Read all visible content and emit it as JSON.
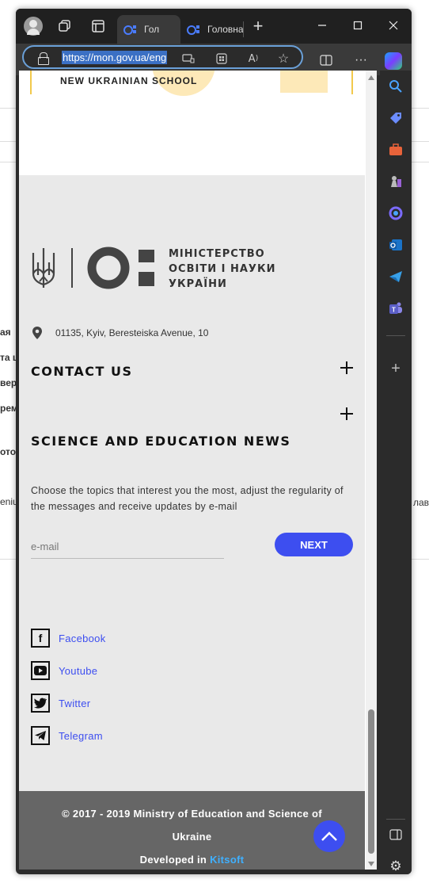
{
  "background_page": {
    "fragments": [
      "ая",
      "та ц",
      "вер",
      "рем",
      "ото",
      "eniu",
      "лав"
    ]
  },
  "browser": {
    "tabs": [
      {
        "title": "Гол",
        "active": true
      },
      {
        "title": "Головна",
        "active": false
      }
    ],
    "url": "https://mon.gov.ua/eng"
  },
  "page": {
    "hero_title": "NEW UKRAINIAN SCHOOL",
    "ministry_name": [
      "МІНІСТЕРСТВО",
      "ОСВІТИ І НАУКИ",
      "УКРАЇНИ"
    ],
    "address": "01135, Kyiv, Beresteiska Avenue, 10",
    "contact_title": "CONTACT US",
    "news_title": "SCIENCE AND EDUCATION NEWS",
    "news_description": "Choose the topics that interest you the most, adjust the regularity of the messages and receive updates by e-mail",
    "email_placeholder": "e-mail",
    "next_label": "NEXT",
    "social": [
      {
        "label": "Facebook",
        "icon": "facebook-icon"
      },
      {
        "label": "Youtube",
        "icon": "youtube-icon"
      },
      {
        "label": "Twitter",
        "icon": "twitter-icon"
      },
      {
        "label": "Telegram",
        "icon": "telegram-icon"
      }
    ],
    "copyright_line1": "© 2017 - 2019 Ministry of Education and Science of",
    "copyright_line2": "Ukraine",
    "developed_prefix": "Developed in",
    "developer": "Kitsoft"
  },
  "colors": {
    "accent": "#3d4ef0",
    "footer_bg": "#e9e9e9",
    "footer_bottom_bg": "#666666",
    "kitsoft_link": "#3fb0ff"
  }
}
